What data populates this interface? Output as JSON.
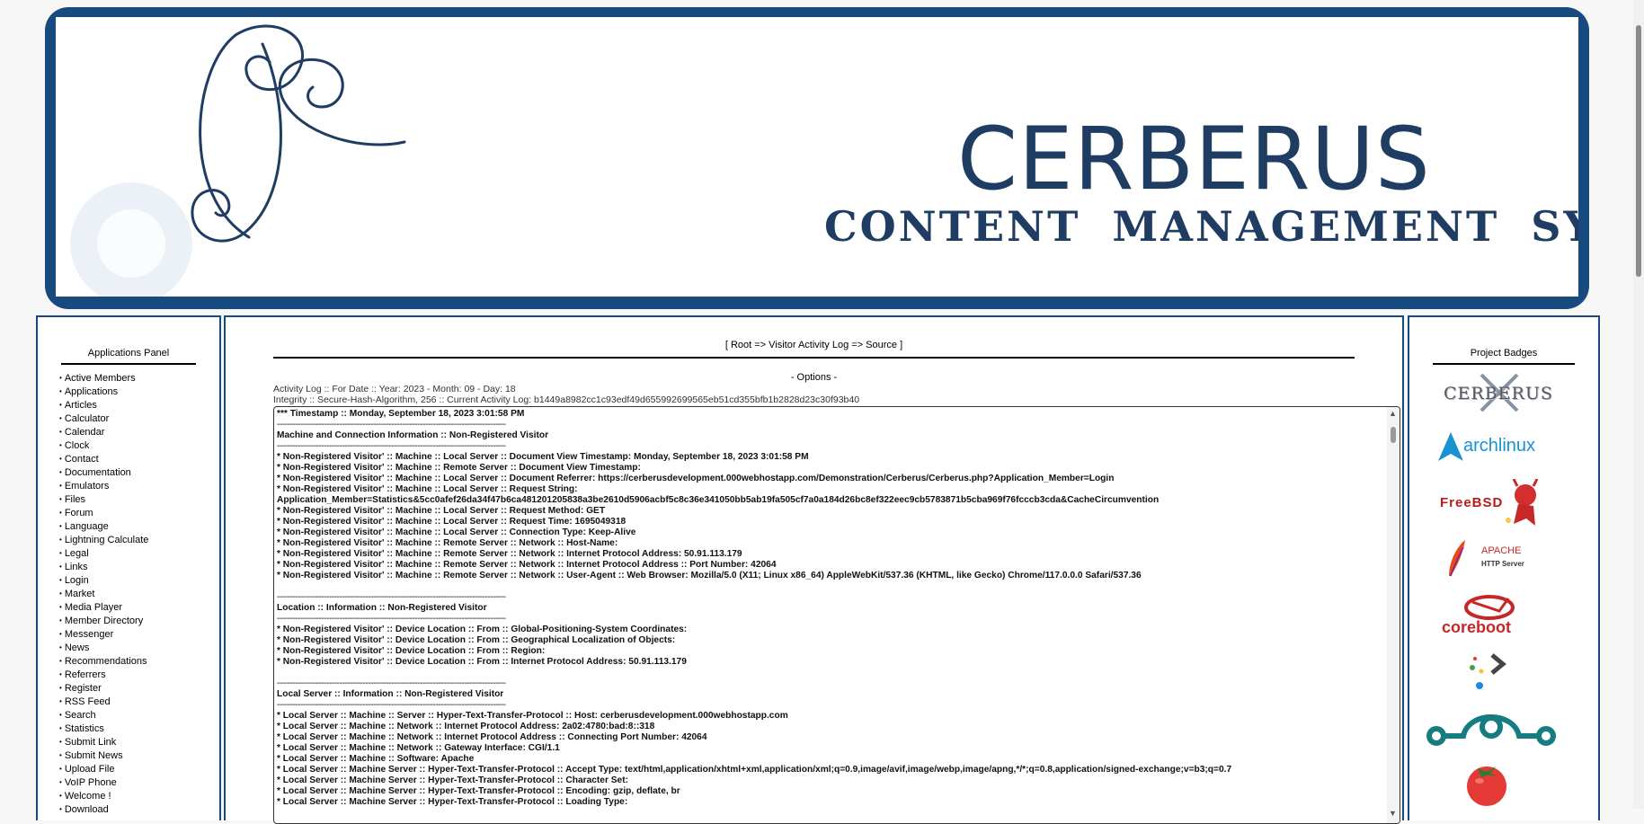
{
  "banner": {
    "title": "CERBERUS",
    "subtitle": "CONTENT MANAGEMENT SYSTEM",
    "accent_color": "#174a7e"
  },
  "applications_panel": {
    "title": "Applications Panel",
    "items": [
      "Active Members",
      "Applications",
      "Articles",
      "Calculator",
      "Calendar",
      "Clock",
      "Contact",
      "Documentation",
      "Emulators",
      "Files",
      "Forum",
      "Language",
      "Lightning Calculate",
      "Legal",
      "Links",
      "Login",
      "Market",
      "Media Player",
      "Member Directory",
      "Messenger",
      "News",
      "Recommendations",
      "Referrers",
      "Register",
      "RSS Feed",
      "Search",
      "Statistics",
      "Submit Link",
      "Submit News",
      "Upload File",
      "VoIP Phone",
      "Welcome !",
      "Download"
    ]
  },
  "main": {
    "breadcrumb": "[ Root => Visitor Activity Log => Source ]",
    "options_label": "- Options -",
    "activity_log_line": "Activity Log :: For Date :: Year: 2023 - Month: 09 - Day: 18",
    "integrity_line": "Integrity :: Secure-Hash-Algorithm, 256 :: Current Activity Log: b1449a8982cc1c93edf49d655992699565eb51cd355bfb1b2828d23c30f93b40",
    "log_lines": [
      "*** Timestamp :: Monday, September 18, 2023 3:01:58 PM",
      "----------------------------------------------------------------------------------------",
      "Machine and Connection Information :: Non-Registered Visitor",
      "----------------------------------------------------------------------------------------",
      "* Non-Registered Visitor' :: Machine :: Local Server :: Document View Timestamp: Monday, September 18, 2023 3:01:58 PM",
      "* Non-Registered Visitor' :: Machine :: Remote Server :: Document View Timestamp:",
      "* Non-Registered Visitor' :: Machine :: Local Server :: Document Referrer: https://cerberusdevelopment.000webhostapp.com/Demonstration/Cerberus/Cerberus.php?Application_Member=Login",
      "* Non-Registered Visitor' :: Machine :: Local Server :: Request String:",
      "Application_Member=Statistics&5cc0afef26da34f47b6ca481201205838a3be2610d5906acbf5c8c36e341050bb5ab19fa505cf7a0a184d26bc8ef322eec9cb5783871b5cba969f76fcccb3cda&CacheCircumvention",
      "* Non-Registered Visitor' :: Machine :: Local Server :: Request Method: GET",
      "* Non-Registered Visitor' :: Machine :: Local Server :: Request Time: 1695049318",
      "* Non-Registered Visitor' :: Machine :: Local Server :: Connection Type: Keep-Alive",
      "* Non-Registered Visitor' :: Machine :: Remote Server :: Network :: Host-Name:",
      "* Non-Registered Visitor' :: Machine :: Remote Server :: Network :: Internet Protocol Address: 50.91.113.179",
      "* Non-Registered Visitor' :: Machine :: Remote Server :: Network :: Internet Protocol Address :: Port Number: 42064",
      "* Non-Registered Visitor' :: Machine :: Remote Server :: Network :: User-Agent :: Web Browser: Mozilla/5.0 (X11; Linux x86_64) AppleWebKit/537.36 (KHTML, like Gecko) Chrome/117.0.0.0 Safari/537.36",
      "",
      "----------------------------------------------------------------------------------------",
      "Location :: Information :: Non-Registered Visitor",
      "----------------------------------------------------------------------------------------",
      "* Non-Registered Visitor' :: Device Location :: From :: Global-Positioning-System Coordinates:",
      "* Non-Registered Visitor' :: Device Location :: From :: Geographical Localization of Objects:",
      "* Non-Registered Visitor' :: Device Location :: From :: Region:",
      "* Non-Registered Visitor' :: Device Location :: From :: Internet Protocol Address: 50.91.113.179",
      "",
      "----------------------------------------------------------------------------------------",
      "Local Server :: Information :: Non-Registered Visitor",
      "----------------------------------------------------------------------------------------",
      "* Local Server :: Machine :: Server :: Hyper-Text-Transfer-Protocol :: Host: cerberusdevelopment.000webhostapp.com",
      "* Local Server :: Machine :: Network :: Internet Protocol Address: 2a02:4780:bad:8::318",
      "* Local Server :: Machine :: Network :: Internet Protocol Address :: Connecting Port Number: 42064",
      "* Local Server :: Machine :: Network :: Gateway Interface: CGI/1.1",
      "* Local Server :: Machine :: Software: Apache",
      "* Local Server :: Machine Server :: Hyper-Text-Transfer-Protocol :: Accept Type: text/html,application/xhtml+xml,application/xml;q=0.9,image/avif,image/webp,image/apng,*/*;q=0.8,application/signed-exchange;v=b3;q=0.7",
      "* Local Server :: Machine Server :: Hyper-Text-Transfer-Protocol :: Character Set:",
      "* Local Server :: Machine Server :: Hyper-Text-Transfer-Protocol :: Encoding: gzip, deflate, br",
      "* Local Server :: Machine Server :: Hyper-Text-Transfer-Protocol :: Loading Type:"
    ]
  },
  "badges_panel": {
    "title": "Project Badges",
    "badges": [
      {
        "name": "cerberus-badge",
        "text": "CERBERUS"
      },
      {
        "name": "archlinux-badge",
        "text": "archlinux"
      },
      {
        "name": "freebsd-badge",
        "text": "FreeBSD"
      },
      {
        "name": "apache-badge",
        "text": "APACHE",
        "subtext": "HTTP Server"
      },
      {
        "name": "coreboot-badge",
        "text": "coreboot"
      },
      {
        "name": "dots-arrow-badge",
        "text": ""
      },
      {
        "name": "lineageos-badge",
        "text": ""
      },
      {
        "name": "tomato-badge",
        "text": ""
      }
    ]
  }
}
